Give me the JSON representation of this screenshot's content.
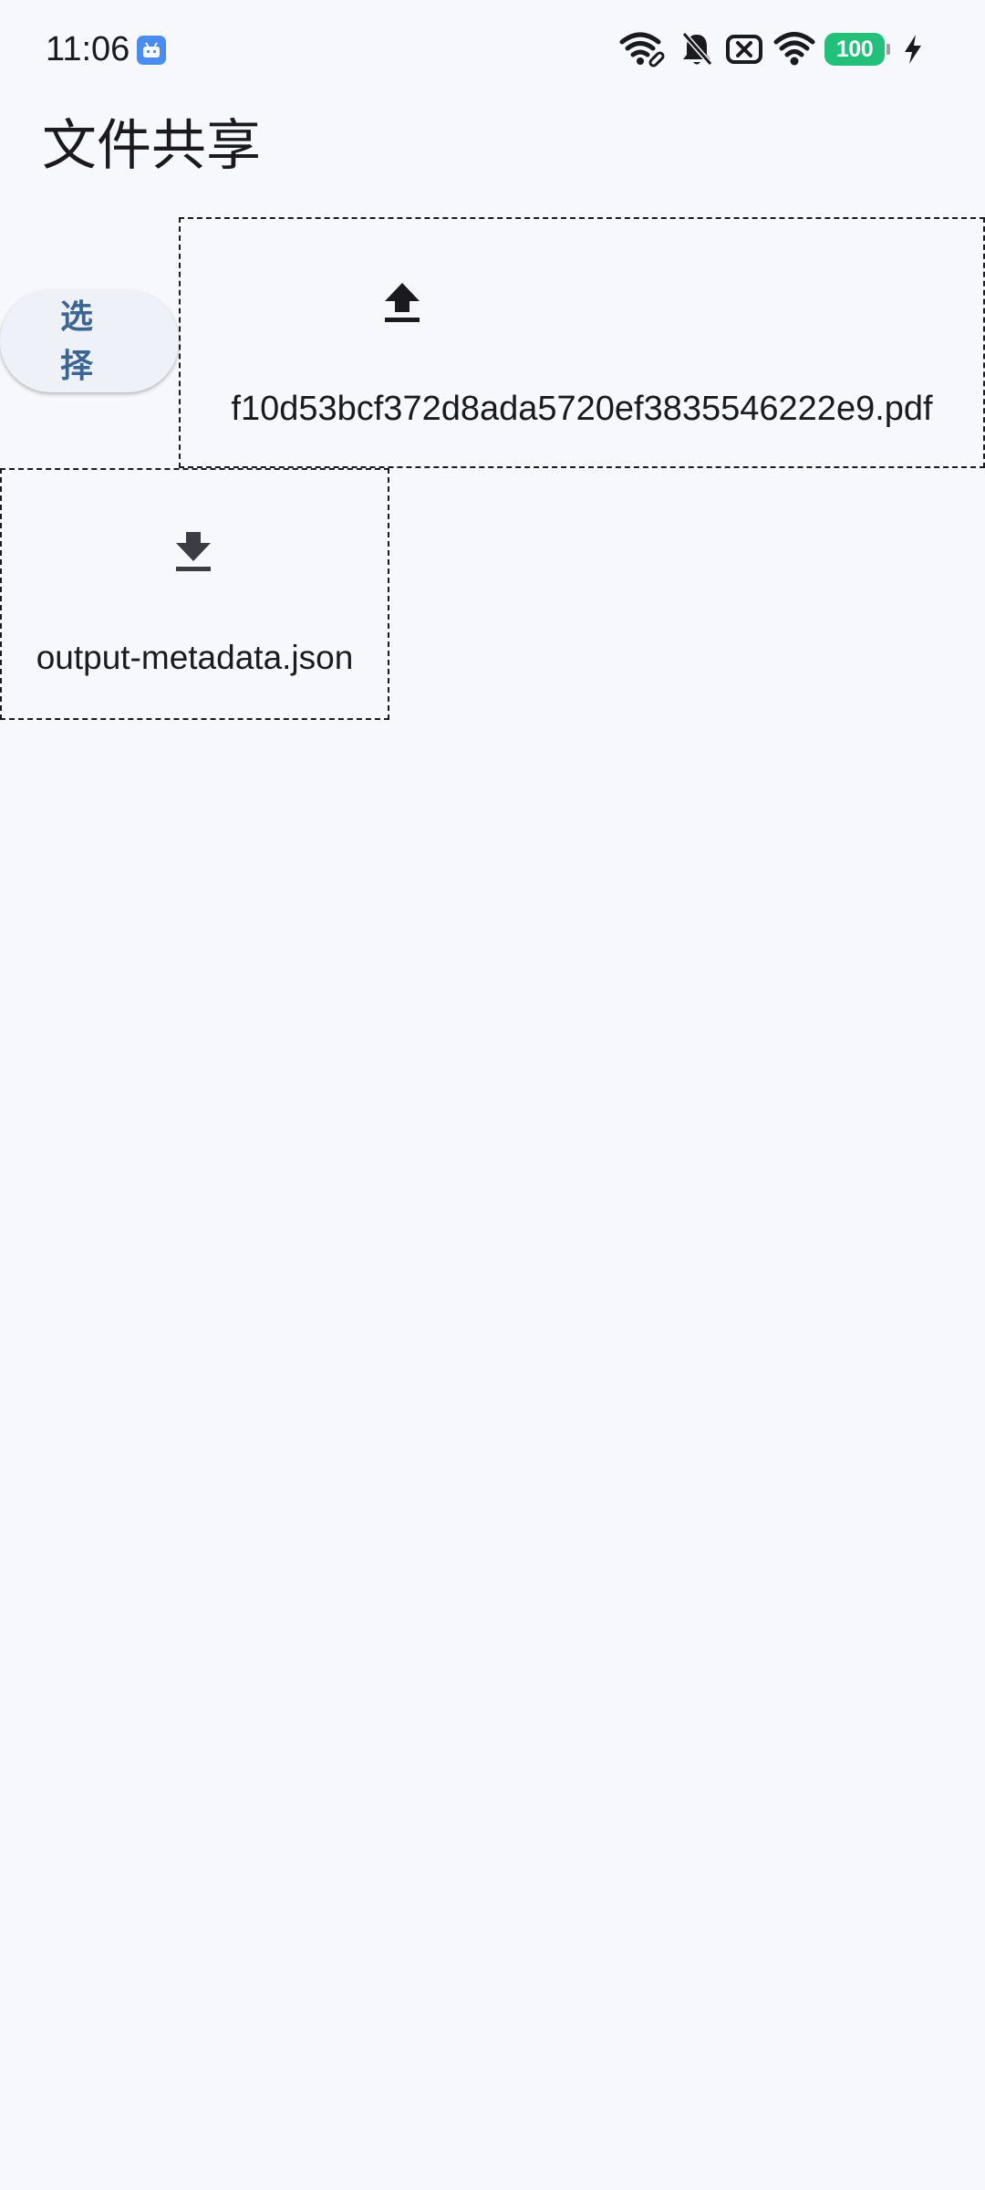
{
  "status_bar": {
    "time": "11:06",
    "battery_level": "100",
    "icons": [
      "android-app-icon",
      "wifi-hotspot-icon",
      "notifications-off-icon",
      "no-sim-icon",
      "wifi-icon",
      "battery-icon",
      "charging-icon"
    ]
  },
  "header": {
    "title": "文件共享"
  },
  "actions": {
    "select_label": "选择"
  },
  "files": [
    {
      "name": "f10d53bcf372d8ada5720ef3835546222e9.pdf",
      "direction": "upload",
      "icon": "upload-icon"
    },
    {
      "name": "output-metadata.json",
      "direction": "download",
      "icon": "download-icon"
    }
  ],
  "colors": {
    "background": "#f7f8fd",
    "text": "#1b1b1f",
    "button_background": "#eff1f8",
    "button_text": "#3c6592",
    "battery": "#22c07a",
    "app_icon": "#4a8cf0"
  }
}
